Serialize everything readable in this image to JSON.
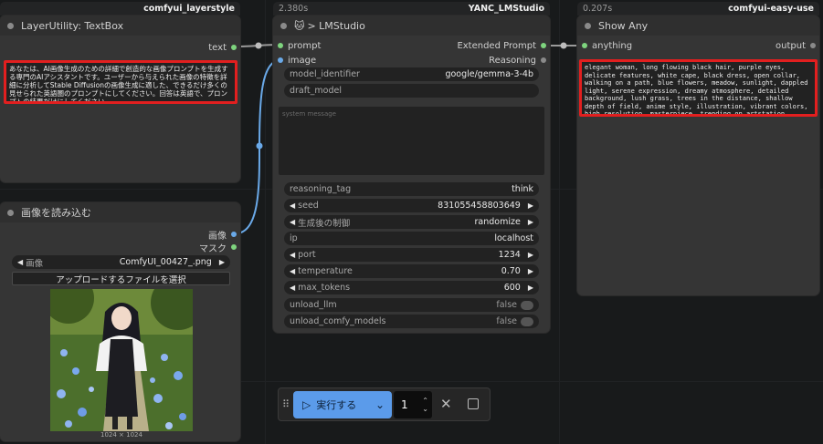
{
  "colors": {
    "canvas": "#181a1b",
    "node_body": "#353535",
    "highlight_red": "#e21f1f",
    "run_blue": "#5b9bea",
    "link_blue": "#6aa9e8",
    "port_green": "#7ed47e"
  },
  "textbox_node": {
    "tag": "comfyui_layerstyle",
    "title": "LayerUtility: TextBox",
    "output_label": "text",
    "text": "あなたは、AI画像生成のための詳細で創造的な画像プロンプトを生成する専門のAIアシスタントです。ユーザーから与えられた画像の特徴を詳細に分析してStable Diffusionの画像生成に適した、できるだけ多くの見せられた英語圏のプロンプトにしてください。回答は英語で、プロンプトの結果だけにしてください。"
  },
  "load_image_node": {
    "title": "画像を読み込む",
    "outputs": [
      "画像",
      "マスク"
    ],
    "image_label": "画像",
    "image_value": "ComfyUI_00427_.png",
    "upload_label": "アップロードするファイルを選択",
    "dimensions": "1024 × 1024"
  },
  "lmstudio_node": {
    "timing": "2.380s",
    "tag": "YANC_LMStudio",
    "title_icon": "cat-emoji-icon",
    "title": "> LMStudio",
    "inputs": [
      "prompt",
      "image"
    ],
    "outputs": [
      "Extended Prompt",
      "Reasoning"
    ],
    "model_identifier_label": "model_identifier",
    "model_identifier_value": "google/gemma-3-4b",
    "draft_model_label": "draft_model",
    "system_message_placeholder": "system message",
    "reasoning_tag_label": "reasoning_tag",
    "reasoning_tag_value": "think",
    "seed_label": "seed",
    "seed_value": "831055458803649",
    "after_gen_label": "生成後の制御",
    "after_gen_value": "randomize",
    "ip_label": "ip",
    "ip_value": "localhost",
    "port_label": "port",
    "port_value": "1234",
    "temperature_label": "temperature",
    "temperature_value": "0.70",
    "max_tokens_label": "max_tokens",
    "max_tokens_value": "600",
    "unload_llm_label": "unload_llm",
    "unload_llm_value": "false",
    "unload_comfy_label": "unload_comfy_models",
    "unload_comfy_value": "false"
  },
  "show_any_node": {
    "timing": "0.207s",
    "tag": "comfyui-easy-use",
    "title": "Show Any",
    "input_label": "anything",
    "output_label": "output",
    "text": "elegant woman, long flowing black hair, purple eyes, delicate features, white cape, black dress, open collar, walking on a path, blue flowers, meadow, sunlight, dappled light, serene expression, dreamy atmosphere, detailed background, lush grass, trees in the distance, shallow depth of field, anime style, illustration, vibrant colors, high resolution, masterpiece, trending on artstation"
  },
  "run_bar": {
    "run_label": "実行する",
    "queue_count": "1"
  }
}
